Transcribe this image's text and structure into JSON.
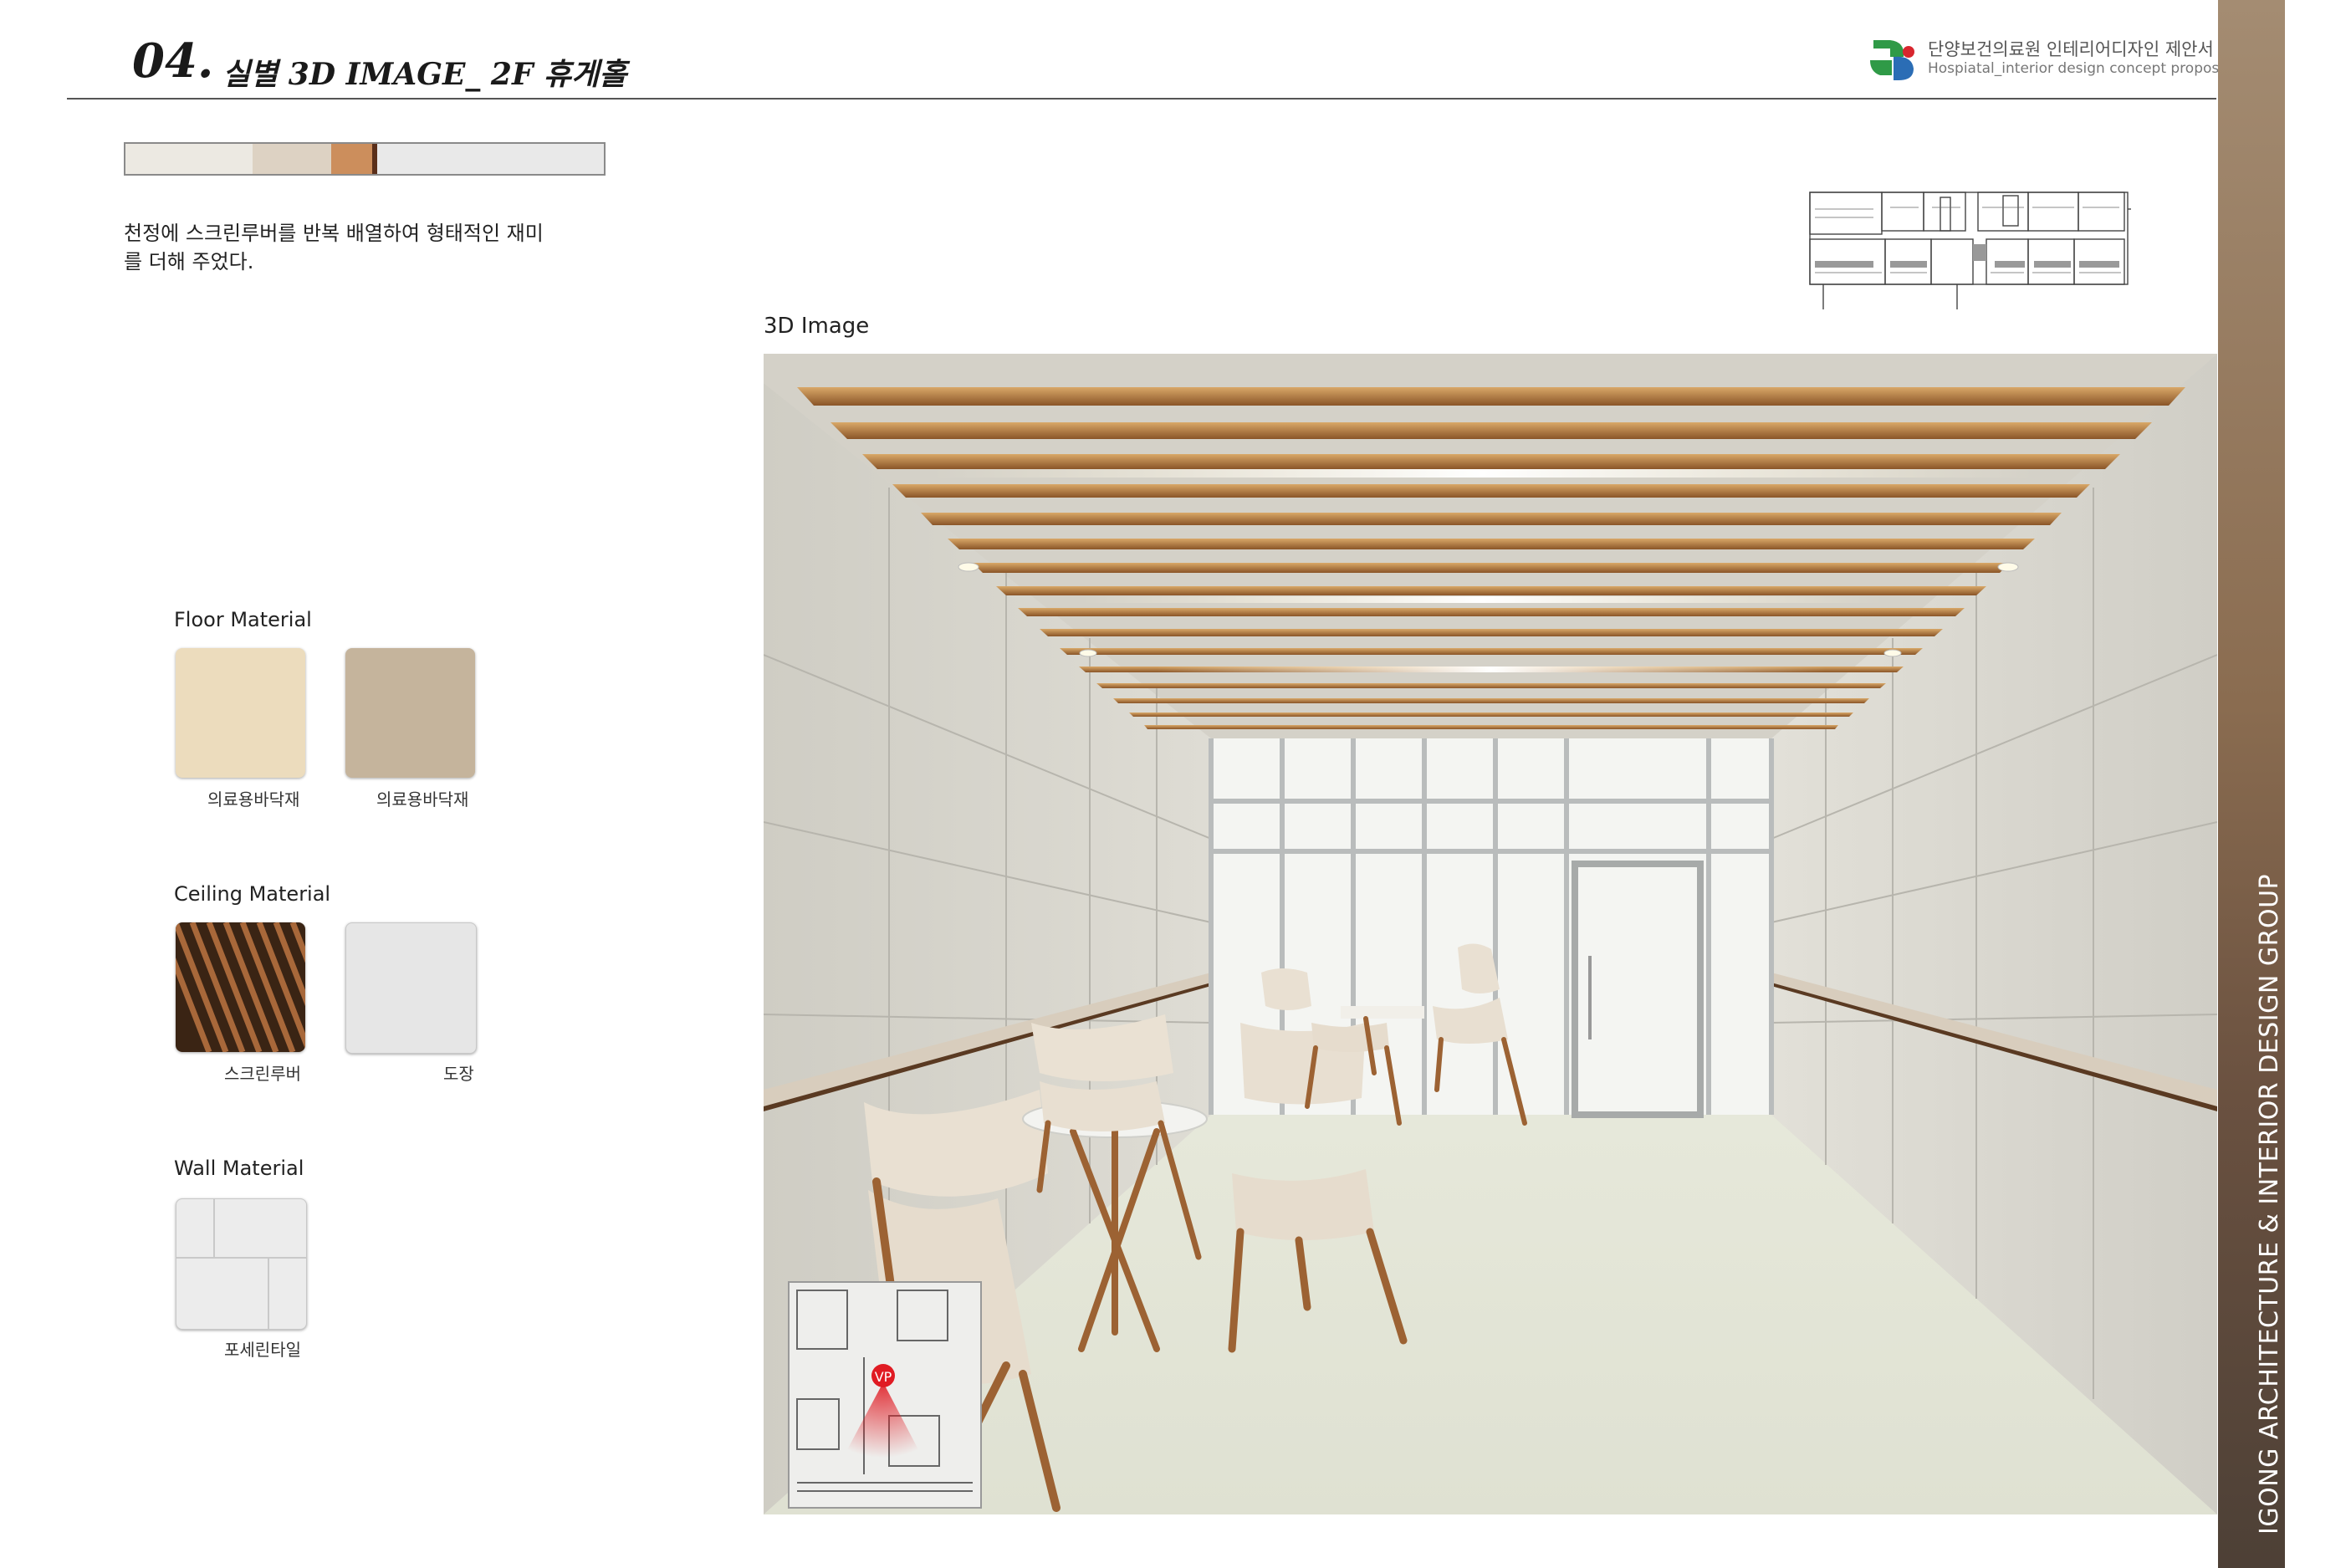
{
  "header": {
    "section_number": "04.",
    "title": "실별 3D IMAGE_ 2F 휴게홀",
    "brand_title": "단양보건의료원 인테리어디자인 제안서",
    "brand_subtitle": "Hospiatal_interior design concept proposal"
  },
  "palette": {
    "colors": [
      "#ece9e2",
      "#ddd2c3",
      "#cc8e5c",
      "#5a2f1a",
      "#e9e9e9"
    ],
    "fractions": [
      0.265,
      0.165,
      0.085,
      0.012,
      0.473
    ]
  },
  "description": {
    "line1": "천정에 스크린루버를 반복 배열하여 형태적인 재미",
    "line2": "를 더해 주었다."
  },
  "image": {
    "caption": "3D Image",
    "viewpoint_label": "VP"
  },
  "materials": {
    "floor": {
      "heading": "Floor Material",
      "items": [
        {
          "label": "의료용바닥재",
          "color": "#ecdcbd"
        },
        {
          "label": "의료용바닥재",
          "color": "#c5b49c"
        }
      ]
    },
    "ceiling": {
      "heading": "Ceiling Material",
      "items": [
        {
          "label": "스크린루버",
          "color": "#6b3a1f"
        },
        {
          "label": "도장",
          "color": "#e6e6e6"
        }
      ]
    },
    "wall": {
      "heading": "Wall Material",
      "items": [
        {
          "label": "포세린타일",
          "color": "#ececec"
        }
      ]
    }
  },
  "side_text": "IGONG ARCHITECTURE  & INTERIOR DESIGN GROUP"
}
